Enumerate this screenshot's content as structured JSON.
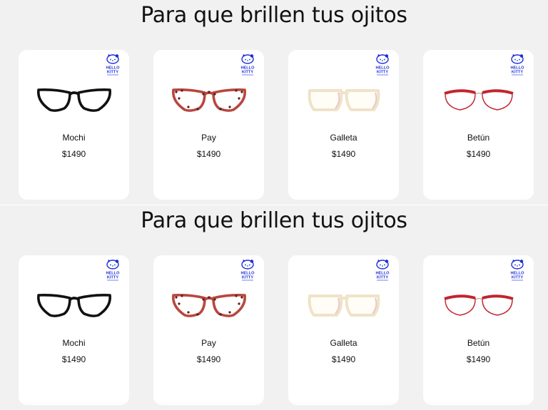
{
  "sections": [
    {
      "title": "Para que brillen tus ojitos",
      "products": [
        {
          "name": "Mochi",
          "price": "$1490",
          "icon": "black-cat-eye-glasses-icon",
          "frame_color": "#111111",
          "lens_tint": "#ffffff"
        },
        {
          "name": "Pay",
          "price": "$1490",
          "icon": "tortoise-cat-eye-glasses-icon",
          "frame_color": "#b8473f",
          "lens_tint": "#fff6f2"
        },
        {
          "name": "Galleta",
          "price": "$1490",
          "icon": "cream-glasses-icon",
          "frame_color": "#efe3c8",
          "lens_tint": "#fffdf6"
        },
        {
          "name": "Betún",
          "price": "$1490",
          "icon": "red-metal-glasses-icon",
          "frame_color": "#c2242e",
          "lens_tint": "#ffffff"
        }
      ]
    },
    {
      "title": "Para que brillen tus ojitos",
      "products": [
        {
          "name": "Mochi",
          "price": "$1490",
          "icon": "black-cat-eye-glasses-icon",
          "frame_color": "#111111",
          "lens_tint": "#ffffff"
        },
        {
          "name": "Pay",
          "price": "$1490",
          "icon": "tortoise-cat-eye-glasses-icon",
          "frame_color": "#b8473f",
          "lens_tint": "#fff6f2"
        },
        {
          "name": "Galleta",
          "price": "$1490",
          "icon": "cream-glasses-icon",
          "frame_color": "#efe3c8",
          "lens_tint": "#fffdf6"
        },
        {
          "name": "Betún",
          "price": "$1490",
          "icon": "red-metal-glasses-icon",
          "frame_color": "#c2242e",
          "lens_tint": "#ffffff"
        }
      ]
    }
  ],
  "brand": {
    "name": "HELLO KITTY",
    "icon": "hello-kitty-logo-icon",
    "color": "#1d2fd8"
  },
  "colors": {
    "page_background": "#f1f1f1",
    "card_background": "#ffffff",
    "text": "#111111"
  }
}
